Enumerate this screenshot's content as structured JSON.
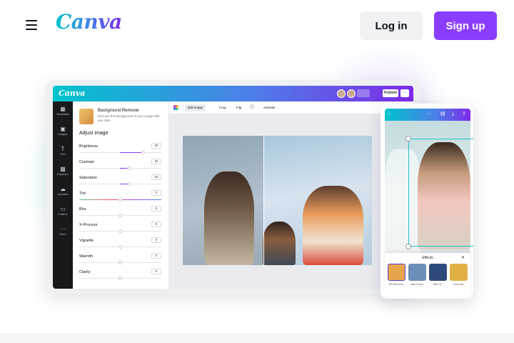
{
  "header": {
    "logo_text": "Canva",
    "login_label": "Log in",
    "signup_label": "Sign up",
    "accent_color": "#8b3dff"
  },
  "editor": {
    "logo_text": "Canva",
    "publish_label": "Publish",
    "more_label": "···",
    "rail": [
      {
        "icon": "layout-icon",
        "glyph": "▦",
        "label": "Templates"
      },
      {
        "icon": "image-icon",
        "glyph": "▣",
        "label": "Images"
      },
      {
        "icon": "text-icon",
        "glyph": "T",
        "label": "Text"
      },
      {
        "icon": "background-icon",
        "glyph": "▩",
        "label": "Keyword"
      },
      {
        "icon": "upload-icon",
        "glyph": "☁",
        "label": "Uploads"
      },
      {
        "icon": "folder-icon",
        "glyph": "▭",
        "label": "Folders"
      },
      {
        "icon": "more-icon",
        "glyph": "···",
        "label": "More"
      }
    ],
    "bg_remover_title": "Background Remover",
    "bg_remover_desc": "Remove the background of your image with one click.",
    "adjust_title": "Adjust image",
    "sliders": [
      {
        "label": "Brightness",
        "value": "30"
      },
      {
        "label": "Contrast",
        "value": "34"
      },
      {
        "label": "Saturation",
        "value": "34"
      },
      {
        "label": "Tint",
        "value": "0"
      },
      {
        "label": "Blur",
        "value": "0"
      },
      {
        "label": "X-Process",
        "value": "0"
      },
      {
        "label": "Vignette",
        "value": "0"
      },
      {
        "label": "Warmth",
        "value": "0"
      },
      {
        "label": "Clarity",
        "value": "0"
      }
    ],
    "toolbar": {
      "edit_image": "Edit image",
      "crop": "Crop",
      "flip": "Flip",
      "info": "ⓘ",
      "animate": "Animate"
    }
  },
  "phone": {
    "effects_title": "Effects",
    "close_label": "✕",
    "effects": [
      {
        "label": "BG Remover",
        "color": "#e7a64b"
      },
      {
        "label": "Auto Focus",
        "color": "#6b8fb6"
      },
      {
        "label": "Blur FX",
        "color": "#2e4a7a"
      },
      {
        "label": "Color Mix",
        "color": "#e0b045"
      }
    ]
  }
}
